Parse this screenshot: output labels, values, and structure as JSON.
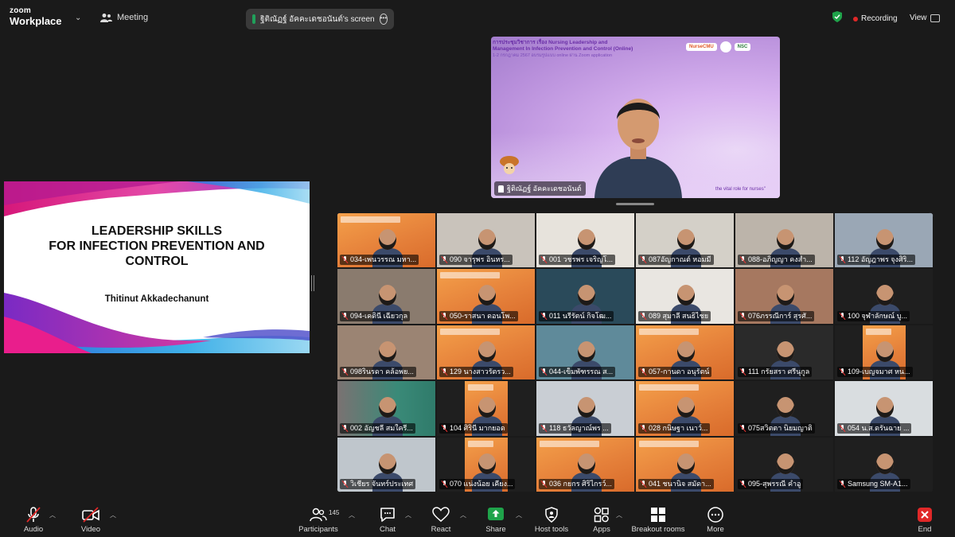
{
  "app": {
    "brand_line1": "zoom",
    "brand_line2": "Workplace",
    "meeting_label": "Meeting"
  },
  "share_pill": {
    "text": "ฐิติณัฏฐ์ อัคคะเดชอนันต์'s screen"
  },
  "status": {
    "recording": "Recording",
    "view": "View"
  },
  "presenter": {
    "banner_line1": "การประชุมวิชาการ เรื่อง Nursing Leadership and",
    "banner_line2": "Management In Infection Prevention and Control  (Online)",
    "banner_line3": "1-2 กรกฎาคม 2567 อบรมรูปแบบ online ผ่าน Zoom application",
    "logo_text": "NurseCMU",
    "logo2_text": "NSC",
    "tagline": "the vital role for nurses\"",
    "name": "ฐิติณัฏฐ์ อัคคะเดชอนันต์"
  },
  "slide": {
    "title_line1": "LEADERSHIP SKILLS",
    "title_line2": "FOR INFECTION PREVENTION AND",
    "title_line3": "CONTROL",
    "author": "Thitinut Akkadechanunt"
  },
  "tiles": [
    {
      "name": "034-เพนวรรณ มหา...",
      "bg": "#6a5a8a",
      "kind": "slide"
    },
    {
      "name": "090   จารุพร อินหร...",
      "bg": "#c9c3bb",
      "kind": "person"
    },
    {
      "name": "001 วชรพร เจริญโ...",
      "bg": "#e7e3dc",
      "kind": "person"
    },
    {
      "name": "087อัญกาณต์ หอมมี",
      "bg": "#d4d0c8",
      "kind": "person"
    },
    {
      "name": "088-อภิญญา คงสำ...",
      "bg": "#bcb4aa",
      "kind": "person"
    },
    {
      "name": "112 อัญฎาพร จุงศิริ...",
      "bg": "#9aa7b5",
      "kind": "person"
    },
    {
      "name": "094-เคดินี เฉียวกุล",
      "bg": "#8a7b6e",
      "kind": "person"
    },
    {
      "name": "050-ราสนา ดอนโพ...",
      "bg": "#e5803a",
      "kind": "slide"
    },
    {
      "name": "011 นรีรัตน์  กิจโฒ...",
      "bg": "#2a4a5a",
      "kind": "person"
    },
    {
      "name": "089 สุมาลี สนธิไชย",
      "bg": "#e9e6e1",
      "kind": "person"
    },
    {
      "name": "076ภรรณีการ์ สุรศั...",
      "bg": "#a67860",
      "kind": "person"
    },
    {
      "name": "100 จุฬาลักษณ์ บู...",
      "bg": "#1f1f1f",
      "kind": "person"
    },
    {
      "name": "098รินรดา คล้อพย...",
      "bg": "#9b8473",
      "kind": "person"
    },
    {
      "name": "129 นางสาวรัตรว...",
      "bg": "#e5803a",
      "kind": "slide"
    },
    {
      "name": "044-เข็มพัฑรรณ ส...",
      "bg": "#5f8a9a",
      "kind": "person"
    },
    {
      "name": "057-กานดา อนุรัตน์",
      "bg": "#e5803a",
      "kind": "slide"
    },
    {
      "name": "111 กรัยสรา ศรีนุกูล",
      "bg": "#2a2a2a",
      "kind": "person"
    },
    {
      "name": "109-เบญจมาศ หน...",
      "bg": "#1f1f1f",
      "kind": "slide"
    },
    {
      "name": "002 อัญชลี สมใครี่...",
      "bg": "#3c7a6a",
      "kind": "blur"
    },
    {
      "name": "104 ศิรินี  มากยอด",
      "bg": "#1f1f1f",
      "kind": "slide"
    },
    {
      "name": "118 ธวัลญาณ์พร ...",
      "bg": "#c9ced4",
      "kind": "person"
    },
    {
      "name": "028 กนิษฐา  เนาว์...",
      "bg": "#e5803a",
      "kind": "slide"
    },
    {
      "name": "075สวิตตา นิยมญาติ",
      "bg": "#1f1f1f",
      "kind": "person"
    },
    {
      "name": "054 น.ส.ดรันฉาย ...",
      "bg": "#d9dde0",
      "kind": "person"
    },
    {
      "name": "วิเชียร จันทร์ประเทศ",
      "bg": "#bfc6cc",
      "kind": "person"
    },
    {
      "name": "070 แน่งน้อย  เคียง...",
      "bg": "#1f1f1f",
      "kind": "slide"
    },
    {
      "name": "036 กยกร ศิริไกรว์...",
      "bg": "#e5803a",
      "kind": "slide"
    },
    {
      "name": "041 ชนานิจ สมัดา...",
      "bg": "#e5803a",
      "kind": "slide"
    },
    {
      "name": "095-สุพรรณี คำอู",
      "bg": "#1f1f1f",
      "kind": "person"
    },
    {
      "name": "Samsung SM-A1...",
      "bg": "#1f1f1f",
      "kind": "person"
    }
  ],
  "toolbar": {
    "audio": "Audio",
    "video": "Video",
    "participants": "Participants",
    "participants_count": "145",
    "chat": "Chat",
    "react": "React",
    "share": "Share",
    "host_tools": "Host tools",
    "apps": "Apps",
    "breakout": "Breakout rooms",
    "more": "More",
    "end": "End"
  },
  "colors": {
    "share_green": "#1fa34a",
    "end_red": "#e02828",
    "slide_orange": "#e5803a"
  }
}
